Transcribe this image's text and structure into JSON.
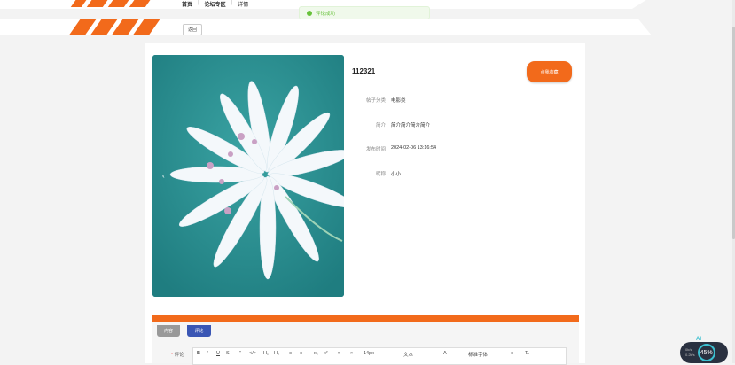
{
  "nav": {
    "items": [
      "首页",
      "论坛专区",
      "详情"
    ]
  },
  "back_label": "返回",
  "toast": {
    "text": "评论成功"
  },
  "post": {
    "title": "112321",
    "fav_label": "点我收藏",
    "fields": [
      {
        "label": "帖子分类",
        "value": "电影类"
      },
      {
        "label": "简介",
        "value": "简介简介简介简介"
      },
      {
        "label": "发布时间",
        "value": "2024-02-06 13:16:54"
      },
      {
        "label": "昵称",
        "value": "小小"
      }
    ]
  },
  "tabs": [
    "内容",
    "评论"
  ],
  "comment_label": "评论",
  "editor_toolbar": {
    "bold": "B",
    "italic": "I",
    "underline": "U",
    "strike": "S",
    "quote": "”",
    "code": "</>",
    "h1": "H₁",
    "h2": "H₂",
    "ol": "≡",
    "ul": "≡",
    "sub": "x₂",
    "sup": "x²",
    "indent_left": "⇤",
    "indent_right": "⇥",
    "size": "14px",
    "text_type": "文本",
    "font": "标准字体",
    "color": "A",
    "align": "≡",
    "clear": "T̶"
  },
  "widget": {
    "up": "0k/s",
    "down": "0.2k/s",
    "percent": "45%",
    "ai": "AI"
  },
  "colors": {
    "accent": "#f26a1b",
    "tab_active": "#3a56b4",
    "success": "#67c23a"
  }
}
